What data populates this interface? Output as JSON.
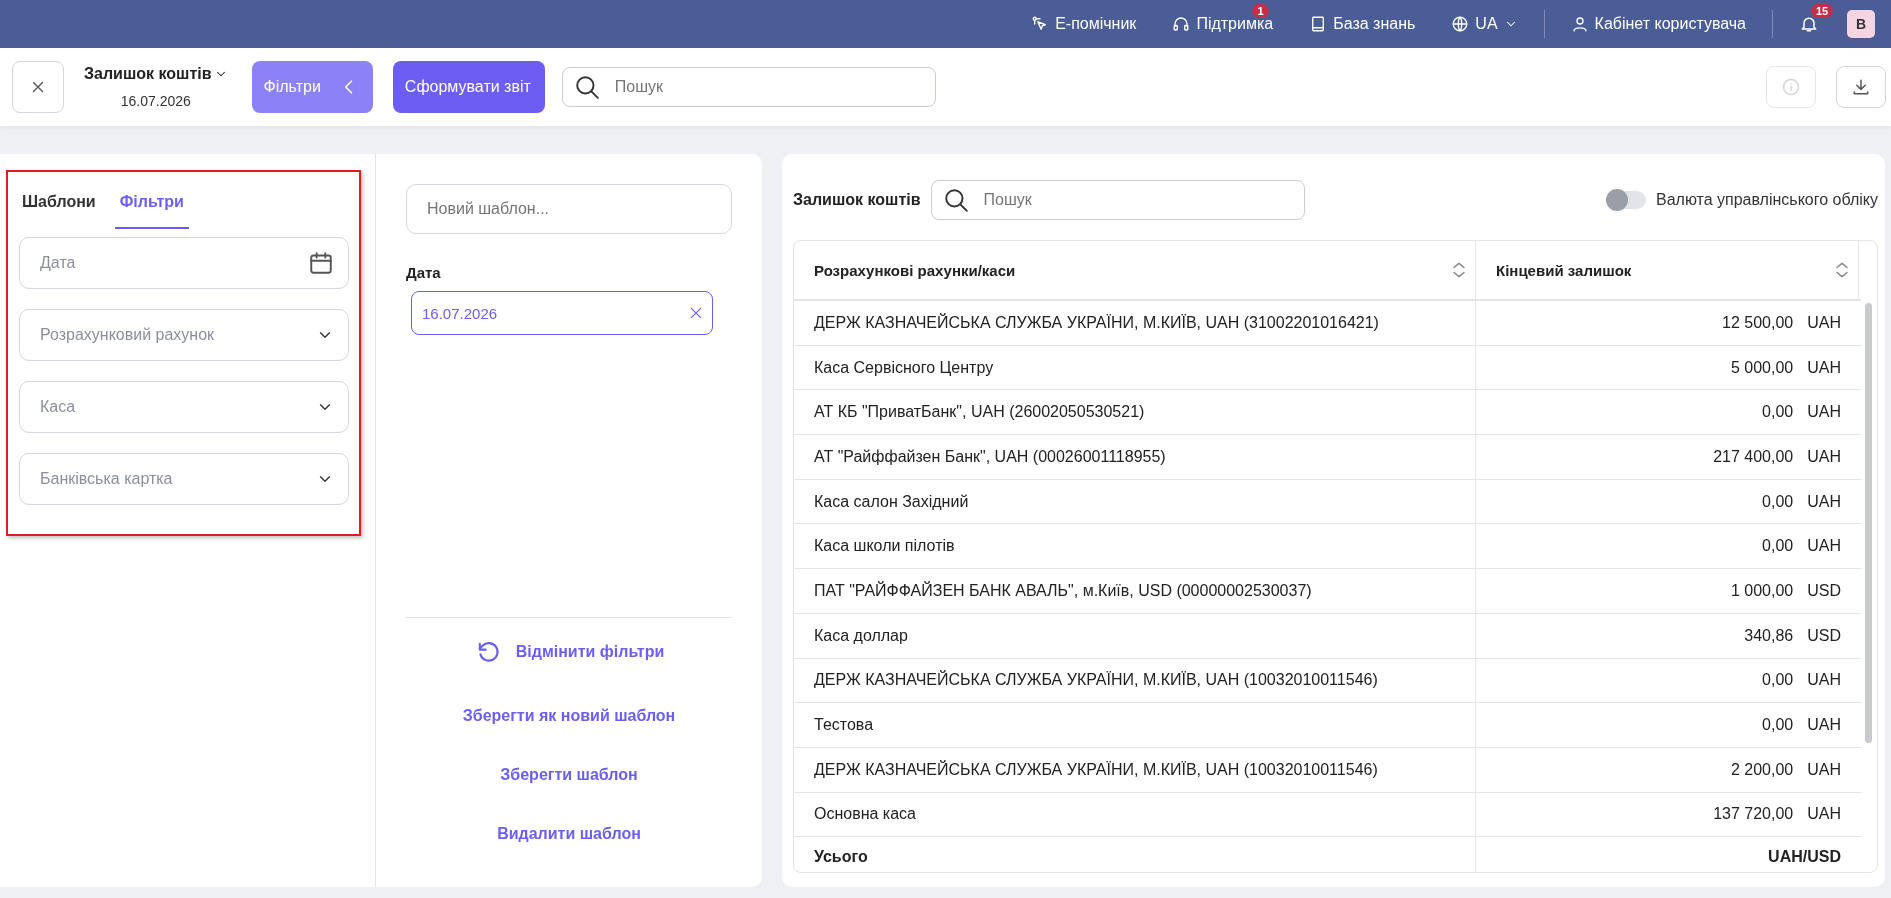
{
  "top_bar": {
    "items": [
      {
        "kind": "assistant",
        "label": "Е-помічник"
      },
      {
        "kind": "support",
        "label": "Підтримка",
        "badge": "1"
      },
      {
        "kind": "knowledge",
        "label": "База знань"
      },
      {
        "kind": "language",
        "label": "UA"
      },
      {
        "kind": "account",
        "label": "Кабінет користувача"
      }
    ],
    "notifications_badge": "15",
    "avatar": "В"
  },
  "toolbar": {
    "report_title": "Залишок коштів",
    "report_date": "16.07.2026",
    "filters_button": "Фільтри",
    "generate_button": "Сформувати звіт",
    "search": {
      "placeholder": "Пошук"
    },
    "info_disabled": true
  },
  "filter_panel": {
    "highlighted": true,
    "tabs": [
      {
        "label": "Шаблони",
        "selected": false
      },
      {
        "label": "Фільтри",
        "selected": true
      }
    ],
    "fields": [
      {
        "kind": "date",
        "placeholder": "Дата"
      },
      {
        "kind": "select",
        "placeholder": "Розрахунковий рахунок"
      },
      {
        "kind": "select",
        "placeholder": "Каса"
      },
      {
        "kind": "select",
        "placeholder": "Банківська картка"
      }
    ]
  },
  "template_panel": {
    "name_field": {
      "placeholder": "Новий шаблон..."
    },
    "date_label": "Дата",
    "date_value": "16.07.2026",
    "reset_link": "Відмінити фільтри",
    "links": [
      "Зберегти як новий шаблон",
      "Зберегти шаблон",
      "Видалити шаблон"
    ]
  },
  "report": {
    "title": "Залишок коштів",
    "search": {
      "placeholder": "Пошук"
    },
    "toggle": {
      "label": "Валюта управлінського обліку",
      "on": false
    },
    "columns": [
      "Розрахункові рахунки/каси",
      "Кінцевий залишок"
    ],
    "rows": [
      {
        "account": "ДЕРЖ КАЗНАЧЕЙСЬКА СЛУЖБА УКРАЇНИ, М.КИЇВ, UAH (31002201016421)",
        "amount": "12 500,00",
        "currency": "UAH"
      },
      {
        "account": "Каса Сервісного Центру",
        "amount": "5 000,00",
        "currency": "UAH"
      },
      {
        "account": "АТ КБ \"ПриватБанк\", UAH (26002050530521)",
        "amount": "0,00",
        "currency": "UAH"
      },
      {
        "account": "АТ \"Райффайзен Банк\", UAH (00026001118955)",
        "amount": "217 400,00",
        "currency": "UAH"
      },
      {
        "account": "Каса салон Західний",
        "amount": "0,00",
        "currency": "UAH"
      },
      {
        "account": "Каса школи пілотів",
        "amount": "0,00",
        "currency": "UAH"
      },
      {
        "account": "ПАТ \"РАЙФФАЙЗЕН БАНК АВАЛЬ\", м.Київ, USD (00000002530037)",
        "amount": "1 000,00",
        "currency": "USD"
      },
      {
        "account": "Каса доллар",
        "amount": "340,86",
        "currency": "USD"
      },
      {
        "account": "ДЕРЖ КАЗНАЧЕЙСЬКА СЛУЖБА УКРАЇНИ, М.КИЇВ, UAH (10032010011546)",
        "amount": "0,00",
        "currency": "UAH"
      },
      {
        "account": "Тестова",
        "amount": "0,00",
        "currency": "UAH"
      },
      {
        "account": "ДЕРЖ КАЗНАЧЕЙСЬКА СЛУЖБА УКРАЇНИ, М.КИЇВ, UAH (10032010011546)",
        "amount": "2 200,00",
        "currency": "UAH"
      },
      {
        "account": "Основна каса",
        "amount": "137 720,00",
        "currency": "UAH"
      }
    ],
    "total": {
      "label": "Усього",
      "value": "UAH/USD"
    }
  }
}
